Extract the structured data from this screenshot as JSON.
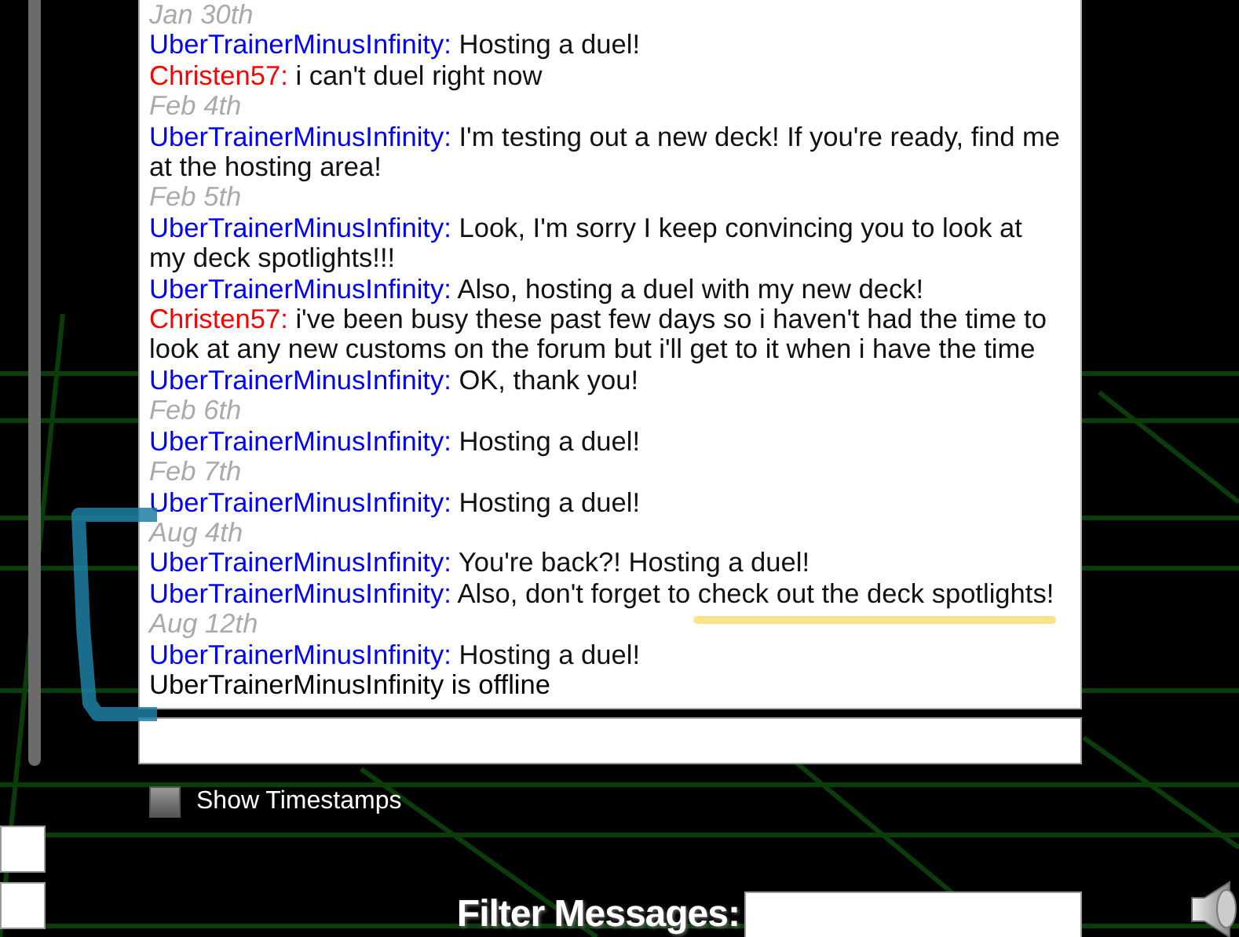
{
  "chat_log": [
    {
      "kind": "date",
      "text": "Jan 30th"
    },
    {
      "kind": "message",
      "user": "UberTrainerMinusInfinity:",
      "color": "#0000ff",
      "text": "Hosting a duel!"
    },
    {
      "kind": "message",
      "user": "Christen57:",
      "color": "#ff0000",
      "text": "i can't duel right now"
    },
    {
      "kind": "date",
      "text": "Feb 4th"
    },
    {
      "kind": "message",
      "user": "UberTrainerMinusInfinity:",
      "color": "#0000ff",
      "text": "I'm testing out a new deck! If you're ready, find me at the hosting area!"
    },
    {
      "kind": "date",
      "text": "Feb 5th"
    },
    {
      "kind": "message",
      "user": "UberTrainerMinusInfinity:",
      "color": "#0000ff",
      "text": "Look, I'm sorry I keep convincing you to look at my deck spotlights!!!"
    },
    {
      "kind": "message",
      "user": "UberTrainerMinusInfinity:",
      "color": "#0000ff",
      "text": "Also, hosting a duel with my new deck!"
    },
    {
      "kind": "message",
      "user": "Christen57:",
      "color": "#ff0000",
      "text": "i've been busy these past few days so i haven't had the time to look at any new customs on the forum but i'll get to it when i have the time"
    },
    {
      "kind": "message",
      "user": "UberTrainerMinusInfinity:",
      "color": "#0000ff",
      "text": "OK, thank you!"
    },
    {
      "kind": "date",
      "text": "Feb 6th"
    },
    {
      "kind": "message",
      "user": "UberTrainerMinusInfinity:",
      "color": "#0000ff",
      "text": "Hosting a duel!"
    },
    {
      "kind": "date",
      "text": "Feb 7th"
    },
    {
      "kind": "message",
      "user": "UberTrainerMinusInfinity:",
      "color": "#0000ff",
      "text": "Hosting a duel!"
    },
    {
      "kind": "date",
      "text": "Aug 4th"
    },
    {
      "kind": "message",
      "user": "UberTrainerMinusInfinity:",
      "color": "#0000ff",
      "text": "You're back?! Hosting a duel!"
    },
    {
      "kind": "message",
      "user": "UberTrainerMinusInfinity:",
      "color": "#0000ff",
      "text": "Also, don't forget to check out the deck spotlights!"
    },
    {
      "kind": "date",
      "text": "Aug 12th"
    },
    {
      "kind": "message",
      "user": "UberTrainerMinusInfinity:",
      "color": "#0000ff",
      "text": "Hosting a duel!"
    },
    {
      "kind": "status",
      "text": "UberTrainerMinusInfinity is offline"
    }
  ],
  "show_timestamps": {
    "label": "Show Timestamps",
    "checked": false
  },
  "filter": {
    "label": "Filter Messages:"
  }
}
